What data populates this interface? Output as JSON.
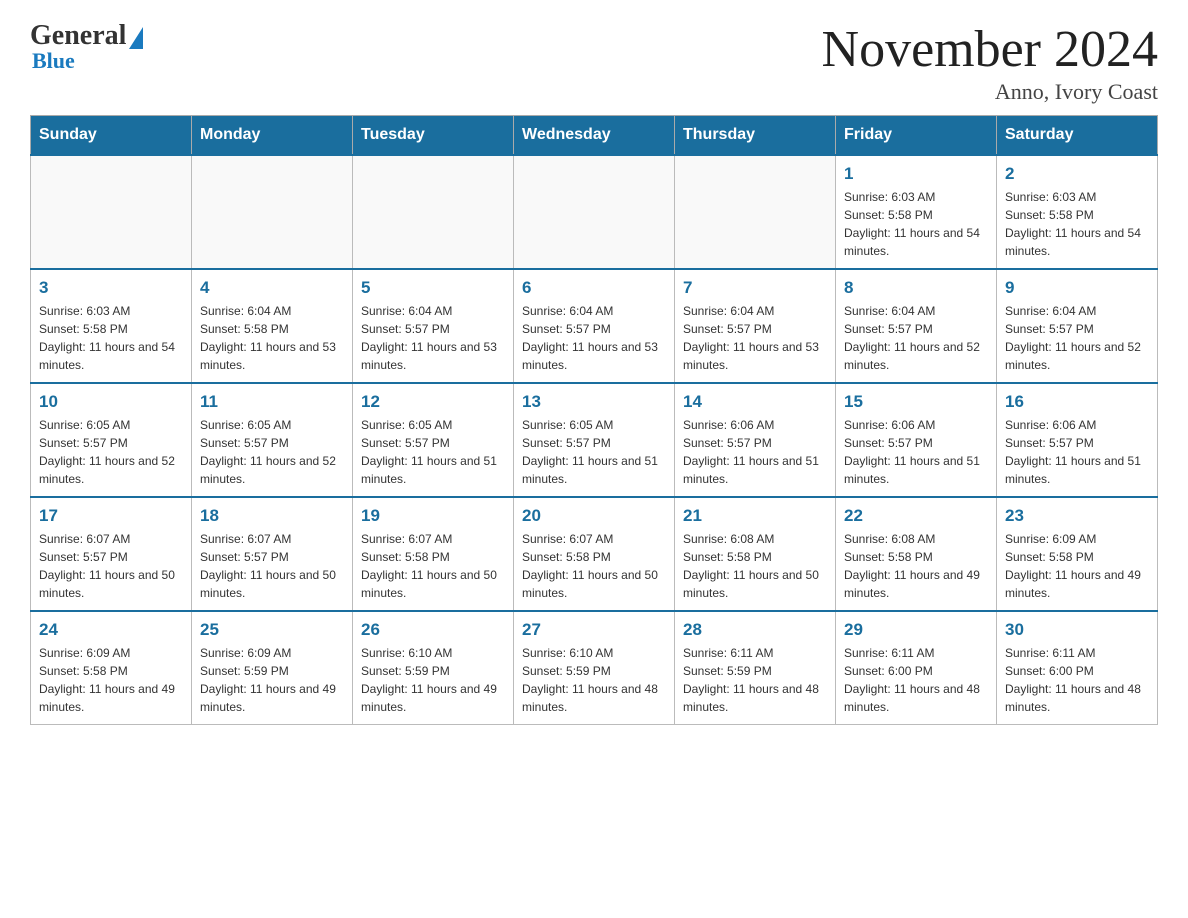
{
  "header": {
    "logo_general": "General",
    "logo_blue": "Blue",
    "month_title": "November 2024",
    "subtitle": "Anno, Ivory Coast"
  },
  "days_of_week": [
    "Sunday",
    "Monday",
    "Tuesday",
    "Wednesday",
    "Thursday",
    "Friday",
    "Saturday"
  ],
  "weeks": [
    [
      {
        "day": "",
        "info": ""
      },
      {
        "day": "",
        "info": ""
      },
      {
        "day": "",
        "info": ""
      },
      {
        "day": "",
        "info": ""
      },
      {
        "day": "",
        "info": ""
      },
      {
        "day": "1",
        "info": "Sunrise: 6:03 AM\nSunset: 5:58 PM\nDaylight: 11 hours and 54 minutes."
      },
      {
        "day": "2",
        "info": "Sunrise: 6:03 AM\nSunset: 5:58 PM\nDaylight: 11 hours and 54 minutes."
      }
    ],
    [
      {
        "day": "3",
        "info": "Sunrise: 6:03 AM\nSunset: 5:58 PM\nDaylight: 11 hours and 54 minutes."
      },
      {
        "day": "4",
        "info": "Sunrise: 6:04 AM\nSunset: 5:58 PM\nDaylight: 11 hours and 53 minutes."
      },
      {
        "day": "5",
        "info": "Sunrise: 6:04 AM\nSunset: 5:57 PM\nDaylight: 11 hours and 53 minutes."
      },
      {
        "day": "6",
        "info": "Sunrise: 6:04 AM\nSunset: 5:57 PM\nDaylight: 11 hours and 53 minutes."
      },
      {
        "day": "7",
        "info": "Sunrise: 6:04 AM\nSunset: 5:57 PM\nDaylight: 11 hours and 53 minutes."
      },
      {
        "day": "8",
        "info": "Sunrise: 6:04 AM\nSunset: 5:57 PM\nDaylight: 11 hours and 52 minutes."
      },
      {
        "day": "9",
        "info": "Sunrise: 6:04 AM\nSunset: 5:57 PM\nDaylight: 11 hours and 52 minutes."
      }
    ],
    [
      {
        "day": "10",
        "info": "Sunrise: 6:05 AM\nSunset: 5:57 PM\nDaylight: 11 hours and 52 minutes."
      },
      {
        "day": "11",
        "info": "Sunrise: 6:05 AM\nSunset: 5:57 PM\nDaylight: 11 hours and 52 minutes."
      },
      {
        "day": "12",
        "info": "Sunrise: 6:05 AM\nSunset: 5:57 PM\nDaylight: 11 hours and 51 minutes."
      },
      {
        "day": "13",
        "info": "Sunrise: 6:05 AM\nSunset: 5:57 PM\nDaylight: 11 hours and 51 minutes."
      },
      {
        "day": "14",
        "info": "Sunrise: 6:06 AM\nSunset: 5:57 PM\nDaylight: 11 hours and 51 minutes."
      },
      {
        "day": "15",
        "info": "Sunrise: 6:06 AM\nSunset: 5:57 PM\nDaylight: 11 hours and 51 minutes."
      },
      {
        "day": "16",
        "info": "Sunrise: 6:06 AM\nSunset: 5:57 PM\nDaylight: 11 hours and 51 minutes."
      }
    ],
    [
      {
        "day": "17",
        "info": "Sunrise: 6:07 AM\nSunset: 5:57 PM\nDaylight: 11 hours and 50 minutes."
      },
      {
        "day": "18",
        "info": "Sunrise: 6:07 AM\nSunset: 5:57 PM\nDaylight: 11 hours and 50 minutes."
      },
      {
        "day": "19",
        "info": "Sunrise: 6:07 AM\nSunset: 5:58 PM\nDaylight: 11 hours and 50 minutes."
      },
      {
        "day": "20",
        "info": "Sunrise: 6:07 AM\nSunset: 5:58 PM\nDaylight: 11 hours and 50 minutes."
      },
      {
        "day": "21",
        "info": "Sunrise: 6:08 AM\nSunset: 5:58 PM\nDaylight: 11 hours and 50 minutes."
      },
      {
        "day": "22",
        "info": "Sunrise: 6:08 AM\nSunset: 5:58 PM\nDaylight: 11 hours and 49 minutes."
      },
      {
        "day": "23",
        "info": "Sunrise: 6:09 AM\nSunset: 5:58 PM\nDaylight: 11 hours and 49 minutes."
      }
    ],
    [
      {
        "day": "24",
        "info": "Sunrise: 6:09 AM\nSunset: 5:58 PM\nDaylight: 11 hours and 49 minutes."
      },
      {
        "day": "25",
        "info": "Sunrise: 6:09 AM\nSunset: 5:59 PM\nDaylight: 11 hours and 49 minutes."
      },
      {
        "day": "26",
        "info": "Sunrise: 6:10 AM\nSunset: 5:59 PM\nDaylight: 11 hours and 49 minutes."
      },
      {
        "day": "27",
        "info": "Sunrise: 6:10 AM\nSunset: 5:59 PM\nDaylight: 11 hours and 48 minutes."
      },
      {
        "day": "28",
        "info": "Sunrise: 6:11 AM\nSunset: 5:59 PM\nDaylight: 11 hours and 48 minutes."
      },
      {
        "day": "29",
        "info": "Sunrise: 6:11 AM\nSunset: 6:00 PM\nDaylight: 11 hours and 48 minutes."
      },
      {
        "day": "30",
        "info": "Sunrise: 6:11 AM\nSunset: 6:00 PM\nDaylight: 11 hours and 48 minutes."
      }
    ]
  ]
}
